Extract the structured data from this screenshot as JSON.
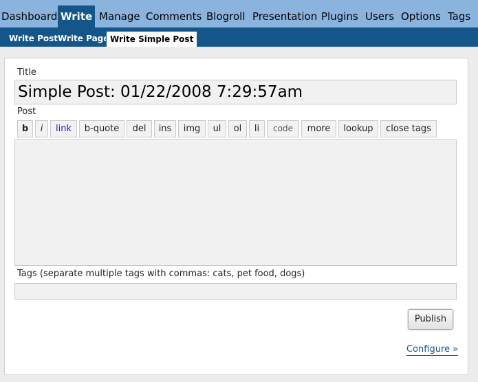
{
  "main_nav": {
    "items": [
      "Dashboard",
      "Write",
      "Manage",
      "Comments",
      "Blogroll",
      "Presentation",
      "Plugins",
      "Users",
      "Options",
      "Tags"
    ],
    "active": "Write"
  },
  "sub_nav": {
    "items": [
      "Write Post",
      "Write Page",
      "Write Simple Post"
    ],
    "active": "Write Simple Post"
  },
  "form": {
    "title_label": "Title",
    "title_value": "Simple Post: 01/22/2008 7:29:57am",
    "post_label": "Post",
    "quicktags": [
      "b",
      "i",
      "link",
      "b-quote",
      "del",
      "ins",
      "img",
      "ul",
      "ol",
      "li",
      "code",
      "more",
      "lookup",
      "close tags"
    ],
    "post_value": "",
    "tags_label": "Tags (separate multiple tags with commas: cats, pet food, dogs)",
    "tags_value": "",
    "publish_label": "Publish",
    "configure_link": "Configure »"
  },
  "colors": {
    "nav_bg": "#8ab3dd",
    "nav_active": "#14568a",
    "link": "#14568a"
  }
}
